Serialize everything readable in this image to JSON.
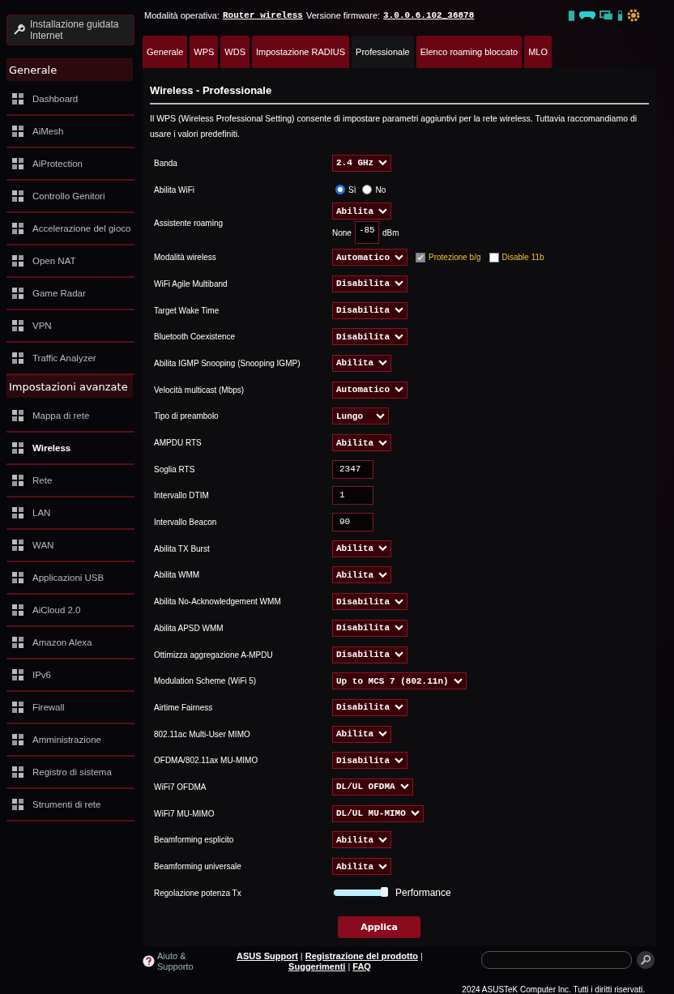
{
  "sidebar": {
    "setup_button": "Installazione guidata Internet",
    "sections": [
      {
        "title": "Generale",
        "items": [
          {
            "label": "Dashboard",
            "selected": false
          },
          {
            "label": "AiMesh",
            "selected": false
          },
          {
            "label": "AiProtection",
            "selected": false
          },
          {
            "label": "Controllo Genitori",
            "selected": false
          },
          {
            "label": "Accelerazione del gioco",
            "selected": false
          },
          {
            "label": "Open NAT",
            "selected": false
          },
          {
            "label": "Game Radar",
            "selected": false
          },
          {
            "label": "VPN",
            "selected": false
          },
          {
            "label": "Traffic Analyzer",
            "selected": false
          }
        ]
      },
      {
        "title": "Impostazioni avanzate",
        "items": [
          {
            "label": "Mappa di rete",
            "selected": false
          },
          {
            "label": "Wireless",
            "selected": true
          },
          {
            "label": "Rete",
            "selected": false
          },
          {
            "label": "LAN",
            "selected": false
          },
          {
            "label": "WAN",
            "selected": false
          },
          {
            "label": "Applicazioni USB",
            "selected": false
          },
          {
            "label": "AiCloud 2.0",
            "selected": false
          },
          {
            "label": "Amazon Alexa",
            "selected": false
          },
          {
            "label": "IPv6",
            "selected": false
          },
          {
            "label": "Firewall",
            "selected": false
          },
          {
            "label": "Amministrazione",
            "selected": false
          },
          {
            "label": "Registro di sistema",
            "selected": false
          },
          {
            "label": "Strumenti di rete",
            "selected": false
          }
        ]
      }
    ]
  },
  "header": {
    "mode_label": "Modalità operativa:",
    "mode": "Router wireless",
    "firmware_label": "Versione firmware:",
    "firmware": "3.0.0.6.102_36878"
  },
  "tabs": [
    {
      "label": "Generale",
      "selected": false
    },
    {
      "label": "WPS",
      "selected": false
    },
    {
      "label": "WDS",
      "selected": false
    },
    {
      "label": "Impostazione RADIUS",
      "selected": false
    },
    {
      "label": "Professionale",
      "selected": true
    },
    {
      "label": "Elenco roaming bloccato",
      "selected": false
    },
    {
      "label": "MLO",
      "selected": false
    }
  ],
  "panel": {
    "title": "Wireless - Professionale",
    "description": "Il WPS (Wireless Professional Setting) consente di impostare parametri aggiuntivi per la rete wireless. Tuttavia raccomandiamo di usare i valori predefiniti.",
    "settings": [
      {
        "label": "Banda",
        "kind": "select",
        "value": "2.4 GHz"
      },
      {
        "label": "Abilita WiFi",
        "kind": "radio",
        "options": [
          {
            "label": "Sì",
            "selected": true
          },
          {
            "label": "No",
            "selected": false
          }
        ]
      },
      {
        "label": "Assistente roaming",
        "kind": "roaming",
        "value": "Abilita",
        "prefix": "None",
        "input": "-85",
        "unit": "dBm"
      },
      {
        "label": "Modalità wireless",
        "kind": "select_checks",
        "value": "Automatico",
        "checks": [
          {
            "label": "Protezione b/g",
            "checked": true,
            "disabled": true
          },
          {
            "label": "Disable 11b",
            "checked": false,
            "disabled": false
          }
        ]
      },
      {
        "label": "WiFi Agile Multiband",
        "kind": "select",
        "value": "Disabilita"
      },
      {
        "label": "Target Wake Time",
        "kind": "select",
        "value": "Disabilita"
      },
      {
        "label": "Bluetooth Coexistence",
        "kind": "select",
        "value": "Disabilita"
      },
      {
        "label": "Abilita IGMP Snooping (Snooping IGMP)",
        "kind": "select",
        "value": "Abilita"
      },
      {
        "label": "Velocità multicast (Mbps)",
        "kind": "select",
        "value": "Automatico"
      },
      {
        "label": "Tipo di preambolo",
        "kind": "select",
        "value": "Lungo"
      },
      {
        "label": "AMPDU RTS",
        "kind": "select",
        "value": "Abilita"
      },
      {
        "label": "Soglia RTS",
        "kind": "text",
        "value": "2347"
      },
      {
        "label": "Intervallo DTIM",
        "kind": "text",
        "value": "1"
      },
      {
        "label": "Intervallo Beacon",
        "kind": "text",
        "value": "90"
      },
      {
        "label": "Abilita TX Burst",
        "kind": "select",
        "value": "Abilita"
      },
      {
        "label": "Abilita WMM",
        "kind": "select",
        "value": "Abilita"
      },
      {
        "label": "Abilita No-Acknowledgement WMM",
        "kind": "select",
        "value": "Disabilita"
      },
      {
        "label": "Abilita APSD WMM",
        "kind": "select",
        "value": "Disabilita"
      },
      {
        "label": "Ottimizza aggregazione A-MPDU",
        "kind": "select",
        "value": "Disabilita"
      },
      {
        "label": "Modulation Scheme (WiFi 5)",
        "kind": "select",
        "value": "Up to MCS 7 (802.11n)"
      },
      {
        "label": "Airtime Fairness",
        "kind": "select",
        "value": "Disabilita"
      },
      {
        "label": "802.11ac Multi-User MIMO",
        "kind": "select",
        "value": "Abilita"
      },
      {
        "label": "OFDMA/802.11ax MU-MIMO",
        "kind": "select",
        "value": "Disabilita"
      },
      {
        "label": "WiFi7 OFDMA",
        "kind": "select",
        "value": "DL/UL OFDMA"
      },
      {
        "label": "WiFi7 MU-MIMO",
        "kind": "select",
        "value": "DL/UL MU-MIMO"
      },
      {
        "label": "Beamforming esplicito",
        "kind": "select",
        "value": "Abilita"
      },
      {
        "label": "Beamforming universale",
        "kind": "select",
        "value": "Abilita"
      },
      {
        "label": "Regolazione potenza Tx",
        "kind": "slider",
        "level": 1,
        "reading": "Performance"
      }
    ],
    "apply_button": "Applica"
  },
  "footer": {
    "help": "Aiuto & Supporto",
    "links": [
      "ASUS Support",
      "Registrazione del prodotto",
      "Suggerimenti",
      "FAQ"
    ],
    "separator": "|",
    "copyright": "2024 ASUSTeK Computer Inc. Tutti i diritti riservati."
  }
}
